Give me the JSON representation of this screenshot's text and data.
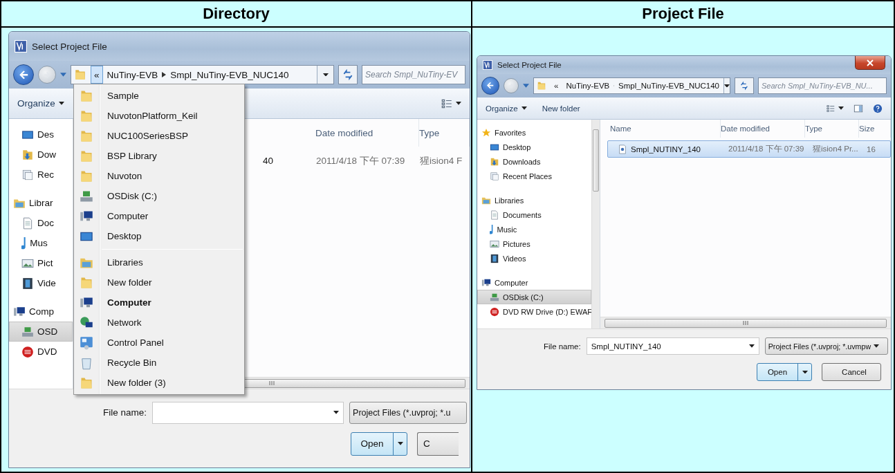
{
  "header": [
    {
      "label": "Directory"
    },
    {
      "label": "Project File"
    }
  ],
  "dialogs": [
    {
      "title": "Select Project File",
      "closable": false,
      "address": {
        "chevron": "«",
        "chevron_pressed": true,
        "segments": [
          "NuTiny-EVB",
          "Smpl_NuTiny-EVB_NUC140"
        ]
      },
      "search_placeholder": "Search Smpl_NuTiny-EV",
      "toolbar": [
        {
          "label": "Organize",
          "kind": "menu"
        }
      ],
      "tool_icons": [
        {
          "kind": "view"
        }
      ],
      "nav_groups": [
        {
          "children": [
            {
              "label": "Des",
              "kind": "desktop",
              "selected": false
            },
            {
              "label": "Dow",
              "kind": "downloads",
              "selected": false
            },
            {
              "label": "Rec",
              "kind": "recent",
              "selected": false
            }
          ]
        },
        {
          "label": "Librar",
          "kind": "library",
          "selected": false,
          "children": [
            {
              "label": "Doc",
              "kind": "document",
              "selected": false
            },
            {
              "label": "Mus",
              "kind": "music",
              "selected": false
            },
            {
              "label": "Pict",
              "kind": "pictures",
              "selected": false
            },
            {
              "label": "Vide",
              "kind": "videos",
              "selected": false
            }
          ]
        },
        {
          "label": "Comp",
          "kind": "computer",
          "selected": false,
          "children": [
            {
              "label": "OSD",
              "kind": "disk",
              "selected": true
            },
            {
              "label": "DVD",
              "kind": "dvd",
              "selected": false
            }
          ]
        }
      ],
      "columns": [
        {
          "kind": "name"
        },
        {
          "kind": "date",
          "label": "Date modified"
        },
        {
          "kind": "type",
          "label": "Type"
        }
      ],
      "rows": [
        {
          "selected": false,
          "cells": [
            "40",
            "2011/4/18 下午 07:39",
            "猩ision4 F"
          ]
        }
      ],
      "menu": {
        "groups": [
          [
            {
              "label": "Sample",
              "kind": "folder",
              "current": false
            },
            {
              "label": "NuvotonPlatform_Keil",
              "kind": "folder",
              "current": false
            },
            {
              "label": "NUC100SeriesBSP",
              "kind": "folder",
              "current": false
            },
            {
              "label": "BSP Library",
              "kind": "folder",
              "current": false
            },
            {
              "label": "Nuvoton",
              "kind": "folder",
              "current": false
            },
            {
              "label": "OSDisk (C:)",
              "kind": "disk",
              "current": false
            },
            {
              "label": "Computer",
              "kind": "computer",
              "current": false
            },
            {
              "label": "Desktop",
              "kind": "desktop",
              "current": false
            }
          ],
          [
            {
              "label": "Libraries",
              "kind": "library",
              "current": false
            },
            {
              "label": "New folder",
              "kind": "folder",
              "current": false
            },
            {
              "label": "Computer",
              "kind": "computer",
              "current": true
            },
            {
              "label": "Network",
              "kind": "network",
              "current": false
            },
            {
              "label": "Control Panel",
              "kind": "control",
              "current": false
            },
            {
              "label": "Recycle Bin",
              "kind": "recycle",
              "current": false
            },
            {
              "label": "New folder (3)",
              "kind": "folder",
              "current": false
            }
          ]
        ]
      },
      "file_name": {
        "label": "File name:"
      },
      "filter": "Project Files (*.uvproj; *.u",
      "buttons": [
        {
          "label": "Open",
          "kind": "split"
        },
        {
          "label": "C",
          "kind": "cut"
        }
      ]
    },
    {
      "title": "Select Project File",
      "closable": true,
      "address": {
        "chevron": "«",
        "chevron_pressed": false,
        "segments": [
          "NuTiny-EVB",
          "Smpl_NuTiny-EVB_NUC140"
        ]
      },
      "search_placeholder": "Search Smpl_NuTiny-EVB_NU...",
      "toolbar": [
        {
          "label": "Organize",
          "kind": "menu"
        },
        {
          "label": "New folder",
          "kind": "plain"
        }
      ],
      "tool_icons": [
        {
          "kind": "view"
        },
        {
          "kind": "preview"
        },
        {
          "kind": "help"
        }
      ],
      "nav_groups": [
        {
          "label": "Favorites",
          "kind": "star",
          "selected": false,
          "children": [
            {
              "label": "Desktop",
              "kind": "desktop",
              "selected": false
            },
            {
              "label": "Downloads",
              "kind": "downloads",
              "selected": false
            },
            {
              "label": "Recent Places",
              "kind": "recent",
              "selected": false
            }
          ]
        },
        {
          "label": "Libraries",
          "kind": "library",
          "selected": false,
          "children": [
            {
              "label": "Documents",
              "kind": "document",
              "selected": false
            },
            {
              "label": "Music",
              "kind": "music",
              "selected": false
            },
            {
              "label": "Pictures",
              "kind": "pictures",
              "selected": false
            },
            {
              "label": "Videos",
              "kind": "videos",
              "selected": false
            }
          ]
        },
        {
          "label": "Computer",
          "kind": "computer",
          "selected": false,
          "children": [
            {
              "label": "OSDisk (C:)",
              "kind": "disk",
              "selected": true
            },
            {
              "label": "DVD RW Drive (D:) EWAF",
              "kind": "dvd",
              "selected": false
            }
          ]
        }
      ],
      "columns": [
        {
          "kind": "name",
          "label": "Name"
        },
        {
          "kind": "date",
          "label": "Date modified"
        },
        {
          "kind": "type",
          "label": "Type"
        },
        {
          "kind": "size",
          "label": "Size"
        }
      ],
      "rows": [
        {
          "selected": true,
          "cells": [
            "Smpl_NUTINY_140",
            "2011/4/18 下午 07:39",
            "猩ision4 Pr...",
            "16"
          ]
        }
      ],
      "file_name": {
        "label": "File name:",
        "value": "Smpl_NUTINY_140"
      },
      "filter": "Project Files (*.uvproj; *.uvmpw",
      "buttons": [
        {
          "label": "Open",
          "kind": "split"
        },
        {
          "label": "Cancel",
          "kind": "plain"
        }
      ]
    }
  ]
}
